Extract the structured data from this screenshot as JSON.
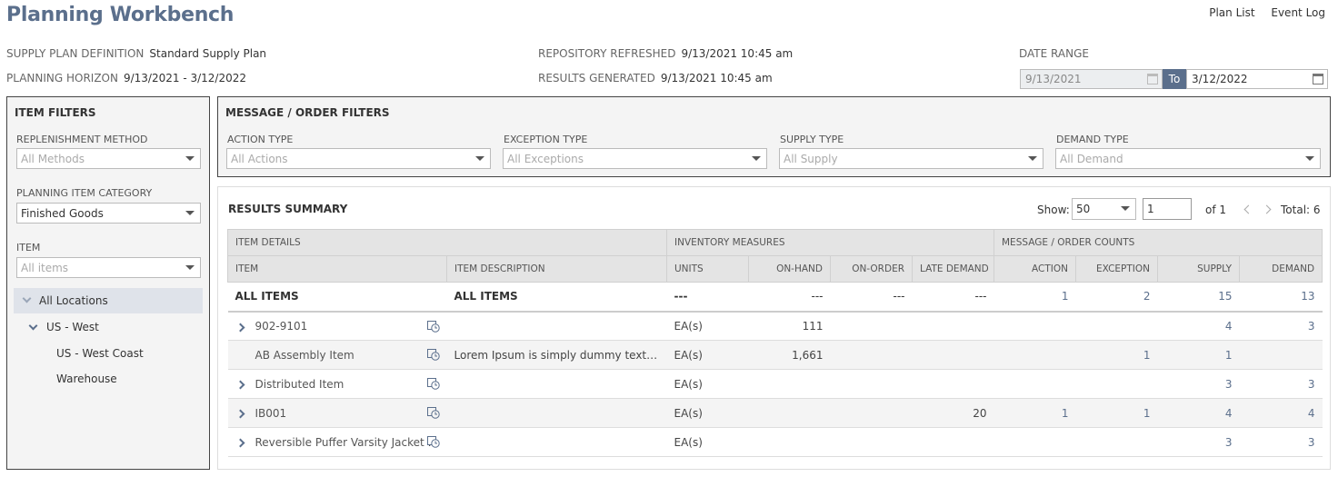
{
  "page": {
    "title": "Planning Workbench"
  },
  "top_links": {
    "plan_list": "Plan List",
    "event_log": "Event Log"
  },
  "meta": {
    "supply_plan_label": "SUPPLY PLAN DEFINITION",
    "supply_plan_value": "Standard Supply Plan",
    "horizon_label": "PLANNING HORIZON",
    "horizon_value": "9/13/2021 - 3/12/2022",
    "repo_label": "REPOSITORY REFRESHED",
    "repo_value": "9/13/2021 10:45 am",
    "results_label": "RESULTS GENERATED",
    "results_value": "9/13/2021 10:45 am",
    "date_range_label": "DATE RANGE",
    "date_from": "9/13/2021",
    "date_to_label": "To",
    "date_to": "3/12/2022"
  },
  "item_filters": {
    "title": "ITEM FILTERS",
    "replenishment_label": "REPLENISHMENT METHOD",
    "replenishment_value": "All Methods",
    "category_label": "PLANNING ITEM CATEGORY",
    "category_value": "Finished Goods",
    "item_label": "ITEM",
    "item_value": "All items",
    "locations": {
      "all": "All Locations",
      "region": "US - West",
      "warehouse": "US - West Coast Warehouse"
    }
  },
  "msg_filters": {
    "title": "MESSAGE / ORDER FILTERS",
    "action_label": "ACTION TYPE",
    "action_value": "All Actions",
    "exception_label": "EXCEPTION TYPE",
    "exception_value": "All Exceptions",
    "supply_label": "SUPPLY TYPE",
    "supply_value": "All Supply",
    "demand_label": "DEMAND TYPE",
    "demand_value": "All Demand"
  },
  "results": {
    "title": "RESULTS SUMMARY",
    "show_label": "Show:",
    "show_value": "50",
    "page_value": "1",
    "of_label": "of 1",
    "total_label": "Total: 6",
    "group_headers": {
      "item_details": "ITEM DETAILS",
      "inventory": "INVENTORY MEASURES",
      "counts": "MESSAGE / ORDER COUNTS"
    },
    "columns": {
      "item": "ITEM",
      "description": "ITEM DESCRIPTION",
      "units": "UNITS",
      "on_hand": "ON-HAND",
      "on_order": "ON-ORDER",
      "late_demand": "LATE DEMAND",
      "action": "ACTION",
      "exception": "EXCEPTION",
      "supply": "SUPPLY",
      "demand": "DEMAND"
    },
    "all_row": {
      "item": "ALL ITEMS",
      "description": "ALL ITEMS",
      "units": "---",
      "on_hand": "---",
      "on_order": "---",
      "late_demand": "---",
      "action": "1",
      "exception": "2",
      "supply": "15",
      "demand": "13"
    },
    "rows": [
      {
        "item": "902-9101",
        "description": "",
        "units": "EA(s)",
        "on_hand": "111",
        "on_order": "",
        "late_demand": "",
        "action": "",
        "exception": "",
        "supply": "4",
        "demand": "3"
      },
      {
        "item": "AB Assembly Item",
        "description": "Lorem Ipsum is simply dummy text of the printing",
        "units": "EA(s)",
        "on_hand": "1,661",
        "on_order": "",
        "late_demand": "",
        "action": "",
        "exception": "1",
        "supply": "1",
        "demand": ""
      },
      {
        "item": "Distributed Item",
        "description": "",
        "units": "EA(s)",
        "on_hand": "",
        "on_order": "",
        "late_demand": "",
        "action": "",
        "exception": "",
        "supply": "3",
        "demand": "3"
      },
      {
        "item": "IB001",
        "description": "",
        "units": "EA(s)",
        "on_hand": "",
        "on_order": "",
        "late_demand": "20",
        "action": "1",
        "exception": "1",
        "supply": "4",
        "demand": "4"
      },
      {
        "item": "Reversible Puffer Varsity Jacket - BLUE",
        "description": "",
        "units": "EA(s)",
        "on_hand": "",
        "on_order": "",
        "late_demand": "",
        "action": "",
        "exception": "",
        "supply": "3",
        "demand": "3"
      }
    ]
  },
  "colors": {
    "accent": "#5b6f8c",
    "header_bg": "#e4e4e4",
    "panel_bg": "#f4f4f4"
  }
}
